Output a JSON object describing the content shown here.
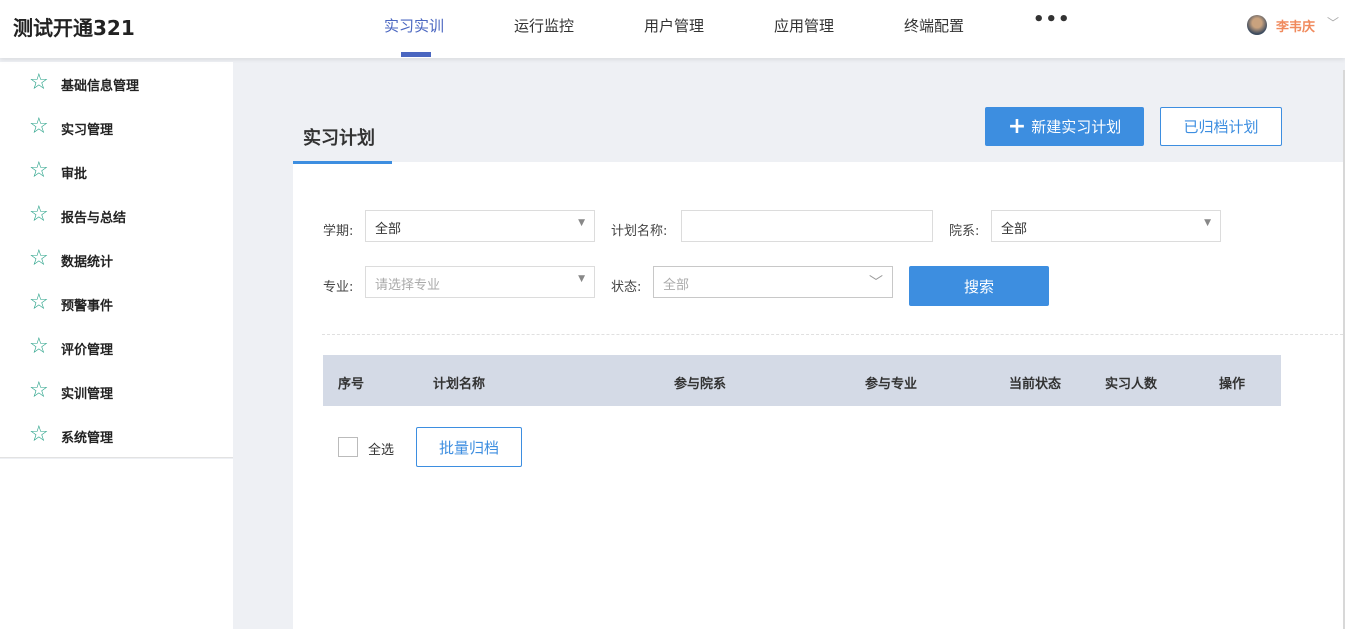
{
  "header": {
    "brand": "测试开通321",
    "nav": [
      "实习实训",
      "运行监控",
      "用户管理",
      "应用管理",
      "终端配置"
    ],
    "more": "•••",
    "user": "李韦庆"
  },
  "sidebar": {
    "items": [
      "基础信息管理",
      "实习管理",
      "审批",
      "报告与总结",
      "数据统计",
      "预警事件",
      "评价管理",
      "实训管理",
      "系统管理"
    ]
  },
  "main": {
    "tab": "实习计划",
    "new_button": "新建实习计划",
    "archived_button": "已归档计划",
    "filters": {
      "term_label": "学期:",
      "term_value": "全部",
      "plan_name_label": "计划名称:",
      "plan_name_value": "",
      "dept_label": "院系:",
      "dept_value": "全部",
      "major_label": "专业:",
      "major_placeholder": "请选择专业",
      "status_label": "状态:",
      "status_value": "全部",
      "search_button": "搜索"
    },
    "table": {
      "columns": [
        "序号",
        "计划名称",
        "参与院系",
        "参与专业",
        "当前状态",
        "实习人数",
        "操作"
      ]
    },
    "select_all": "全选",
    "batch_archive": "批量归档"
  },
  "colors": {
    "accent": "#3d8ee0",
    "nav_active": "#4a66c0",
    "user": "#f08a5d",
    "star": "#2ba38a"
  }
}
